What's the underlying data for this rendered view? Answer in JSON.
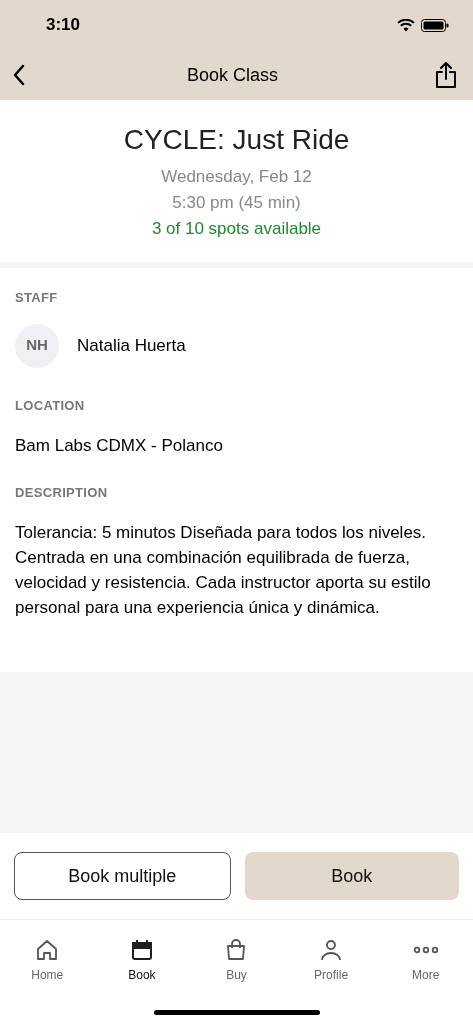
{
  "status_bar": {
    "time": "3:10"
  },
  "nav": {
    "title": "Book Class"
  },
  "class": {
    "title": "CYCLE: Just Ride",
    "date": "Wednesday, Feb 12",
    "time": "5:30 pm (45 min)",
    "availability": "3 of 10 spots available"
  },
  "staff": {
    "heading": "STAFF",
    "initials": "NH",
    "name": "Natalia Huerta"
  },
  "location": {
    "heading": "LOCATION",
    "name": "Bam Labs CDMX - Polanco"
  },
  "description": {
    "heading": "DESCRIPTION",
    "text": "Tolerancia: 5 minutos Diseñada para todos los niveles. Centrada en una combinación equilibrada de fuerza, velocidad y resistencia. Cada instructor aporta su estilo personal para una experiencia única y dinámica."
  },
  "actions": [
    {
      "label": "Book multiple",
      "kind": "outline"
    },
    {
      "label": "Book",
      "kind": "filled"
    }
  ],
  "tab_bar": [
    {
      "label": "Home",
      "kind": "home",
      "selected": false
    },
    {
      "label": "Book",
      "kind": "calendar",
      "selected": true
    },
    {
      "label": "Buy",
      "kind": "bag",
      "selected": false
    },
    {
      "label": "Profile",
      "kind": "person",
      "selected": false
    },
    {
      "label": "More",
      "kind": "more",
      "selected": false
    }
  ]
}
